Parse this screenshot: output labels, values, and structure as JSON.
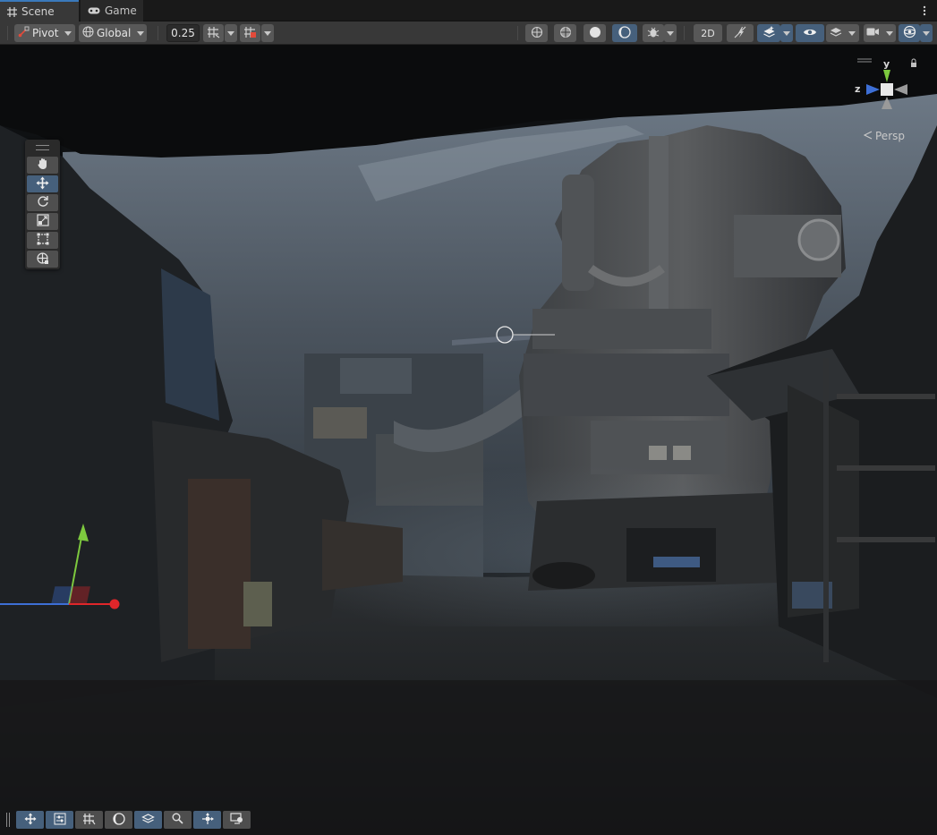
{
  "tabs": [
    {
      "label": "Scene",
      "icon": "grid-hash-icon",
      "active": true
    },
    {
      "label": "Game",
      "icon": "gamepad-icon",
      "active": false
    }
  ],
  "toolbar": {
    "pivot_label": "Pivot",
    "global_label": "Global",
    "snap_value": "0.25",
    "toggle_2d_label": "2D"
  },
  "gizmo": {
    "y_label": "y",
    "z_label": "z",
    "persp_label": "Persp"
  },
  "colors": {
    "accent": "#46607c",
    "axis_x": "#e0262a",
    "axis_y": "#7dc93e",
    "axis_z": "#3d6fd6",
    "panel": "#383838"
  }
}
